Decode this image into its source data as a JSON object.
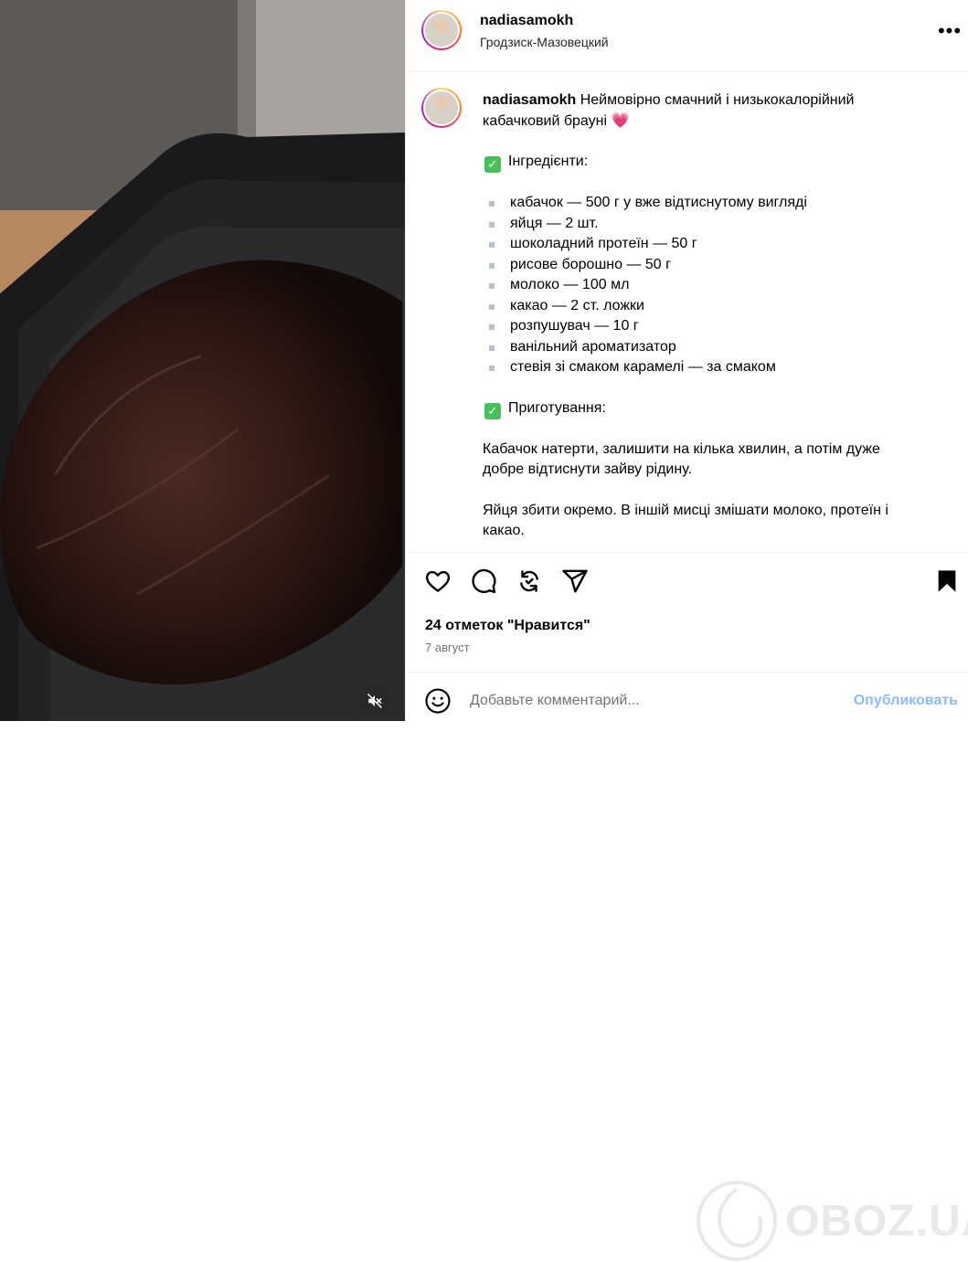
{
  "post": {
    "username": "nadiasamokh",
    "location": "Гродзиск-Мазовецкий"
  },
  "caption": {
    "username": "nadiasamokh",
    "intro": "Неймовірно смачний і низькокалорійний кабачковий брауні",
    "heart": "💗",
    "ingredients_title": "Інгредієнти:",
    "ingredients": [
      "кабачок — 500 г у вже відтиснутому вигляді",
      "яйця — 2 шт.",
      "шоколадний протеїн — 50 г",
      "рисове борошно — 50 г",
      "молоко — 100 мл",
      "какао — 2 ст. ложки",
      "розпушувач — 10 г",
      "ванільний ароматизатор",
      "стевія зі смаком карамелі — за смаком"
    ],
    "prep_title": "Приготування:",
    "prep_steps": [
      "Кабачок натерти, залишити на кілька хвилин, а потім дуже добре відтиснути зайву рідину.",
      "Яйця збити окремо. В іншій мисці змішати молоко, протеїн і какао."
    ]
  },
  "stats": {
    "likes": "24 отметок \"Нравится\"",
    "date": "7 август"
  },
  "comment": {
    "placeholder": "Добавьте комментарий...",
    "publish": "Опубликовать"
  },
  "watermark": "OBOZ.UA",
  "colors": {
    "accent_blue": "#0095f6",
    "check_green": "#47c05c",
    "heart_pink": "#e0245e"
  }
}
